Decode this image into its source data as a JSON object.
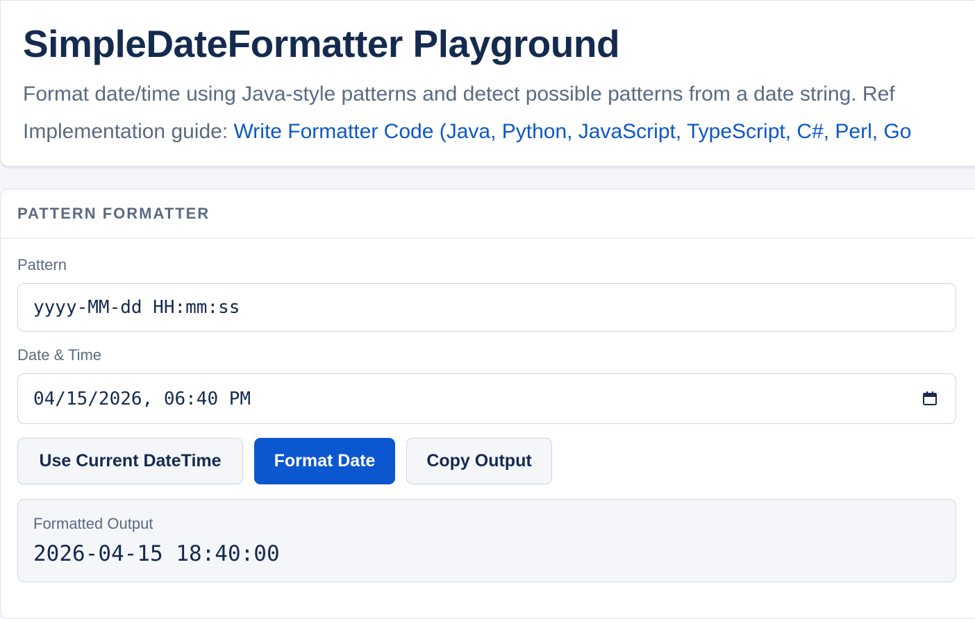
{
  "header": {
    "title": "SimpleDateFormatter Playground",
    "subtitle": "Format date/time using Java-style patterns and detect possible patterns from a date string. Ref",
    "guide_prefix": "Implementation guide: ",
    "guide_link": "Write Formatter Code (Java, Python, JavaScript, TypeScript, C#, Perl, Go"
  },
  "formatter": {
    "section_title": "PATTERN FORMATTER",
    "pattern_label": "Pattern",
    "pattern_value": "yyyy-MM-dd HH:mm:ss",
    "datetime_label": "Date & Time",
    "datetime_value": "04/15/2026, 06:40 PM",
    "datetime_icon": "calendar-icon",
    "buttons": {
      "use_current": "Use Current DateTime",
      "format": "Format Date",
      "copy": "Copy Output"
    },
    "output_label": "Formatted Output",
    "output_value": "2026-04-15 18:40:00"
  },
  "colors": {
    "title": "#142a4f",
    "link": "#0b57c9",
    "primary_button": "#0b57d0",
    "muted_text": "#5a6a82"
  }
}
